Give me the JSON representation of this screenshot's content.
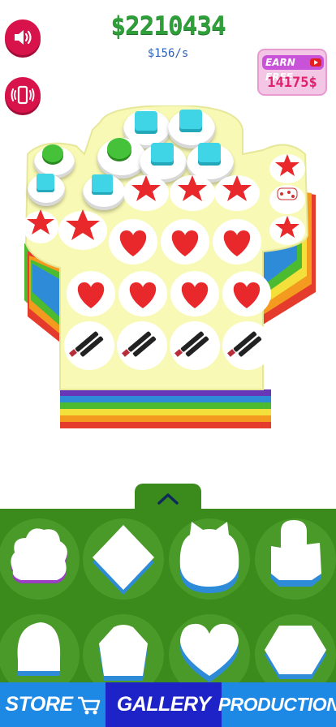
{
  "hud": {
    "money": "$2210434",
    "rate": "$156/s",
    "earn_free_label": "EARN FREE",
    "earn_free_amount": "14175$"
  },
  "controls": {
    "sound_icon": "speaker-icon",
    "vibration_icon": "phone-vibrate-icon"
  },
  "board": {
    "shape": "cactus",
    "items": [
      "green-gem",
      "cyan-cube",
      "red-star",
      "white-candy",
      "red-heart",
      "lipstick"
    ]
  },
  "shapes_panel": {
    "toggle_icon": "chevron-up-icon",
    "shapes": [
      "flower",
      "diamond",
      "cat",
      "cactus",
      "mushroom",
      "shield",
      "heart",
      "hexagon"
    ]
  },
  "nav": {
    "store": "STORE",
    "gallery": "GALLERY",
    "production": "PRODUCTION"
  },
  "colors": {
    "store_bg": "#1e88e5",
    "gallery_bg": "#1e23c8",
    "production_bg": "#1e88e5",
    "panel_bg": "#3a8a1c",
    "money": "#2f9f3a",
    "button_red": "#d8124a"
  }
}
